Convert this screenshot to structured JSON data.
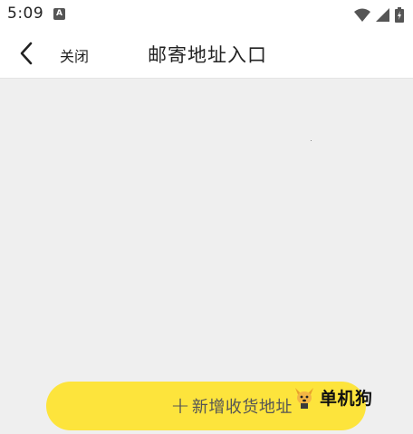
{
  "status_bar": {
    "time": "5:09",
    "notification_glyph": "A",
    "icons": [
      "wifi-icon",
      "signal-icon",
      "battery-icon"
    ]
  },
  "header": {
    "close_label": "关闭",
    "title": "邮寄地址入口",
    "back_icon": "chevron-left-icon"
  },
  "footer": {
    "add_button_label": "新增收货地址",
    "add_icon": "plus-icon"
  },
  "watermark": {
    "text": "单机狗",
    "logo": "dog-logo-icon"
  },
  "colors": {
    "accent": "#fde43c",
    "background": "#efefef",
    "header_bg": "#ffffff"
  }
}
